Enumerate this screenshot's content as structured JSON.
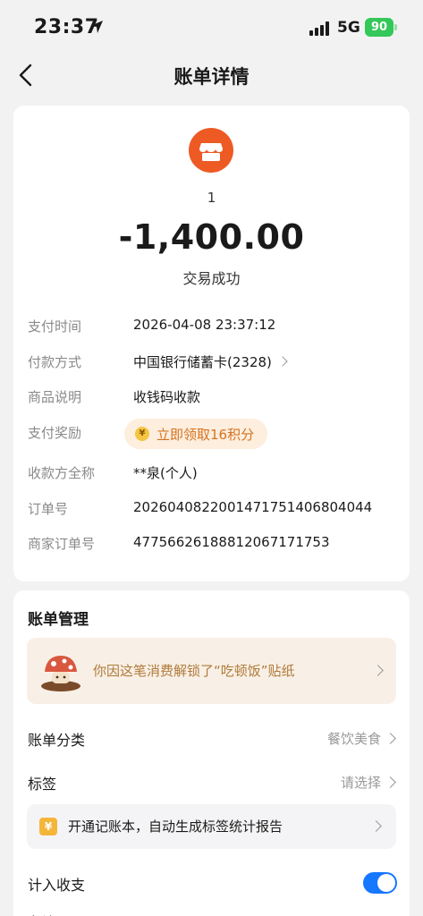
{
  "status_bar": {
    "time": "23:37",
    "network": "5G",
    "battery": "90"
  },
  "header": {
    "title": "账单详情"
  },
  "summary": {
    "merchant": "1",
    "amount": "-1,400.00",
    "status": "交易成功"
  },
  "details": [
    {
      "label": "支付时间",
      "value": "2026-04-08 23:37:12"
    },
    {
      "label": "付款方式",
      "value": "中国银行储蓄卡(2328)"
    },
    {
      "label": "商品说明",
      "value": "收钱码收款"
    },
    {
      "label": "支付奖励",
      "value": "立即领取16积分"
    },
    {
      "label": "收款方全称",
      "value": "**泉(个人)"
    },
    {
      "label": "订单号",
      "value": "2026040822001471751406804044"
    },
    {
      "label": "商家订单号",
      "value": "4775662618881206717175​3"
    }
  ],
  "management": {
    "title": "账单管理",
    "sticker_text": "你因这笔消费解锁了“吃顿饭”贴纸",
    "category_label": "账单分类",
    "category_value": "餐饮美食",
    "tag_label": "标签",
    "tag_value": "请选择",
    "ledger_text": "开通记账本，自动生成标签统计报告",
    "include_label": "计入收支",
    "include_enabled": true,
    "remark_label": "备注"
  },
  "colors": {
    "accent": "#1677ff",
    "merchant_icon": "#ee5a24",
    "reward": "#d4731f"
  }
}
